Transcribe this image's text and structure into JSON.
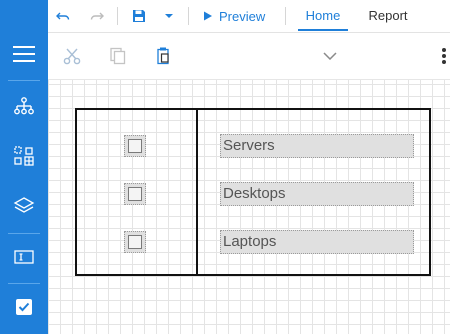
{
  "toolbar": {
    "preview_label": "Preview",
    "tabs": [
      {
        "label": "Home",
        "active": true
      },
      {
        "label": "Report",
        "active": false
      }
    ]
  },
  "rail": {
    "items": [
      "menu-icon",
      "report-explorer-icon",
      "field-list-icon",
      "layers-icon",
      "properties-icon",
      "validate-icon"
    ]
  },
  "ribbon": {
    "items": [
      "cut-icon",
      "copy-icon",
      "paste-icon",
      "chevron-down-icon",
      "more-icon"
    ]
  },
  "report": {
    "rows": [
      {
        "label": "Servers",
        "checked": false
      },
      {
        "label": "Desktops",
        "checked": false
      },
      {
        "label": "Laptops",
        "checked": false
      }
    ]
  },
  "colors": {
    "accent": "#1f7fd9",
    "rail": "#1f7fd9",
    "cell_fill": "#e0e0e0"
  }
}
